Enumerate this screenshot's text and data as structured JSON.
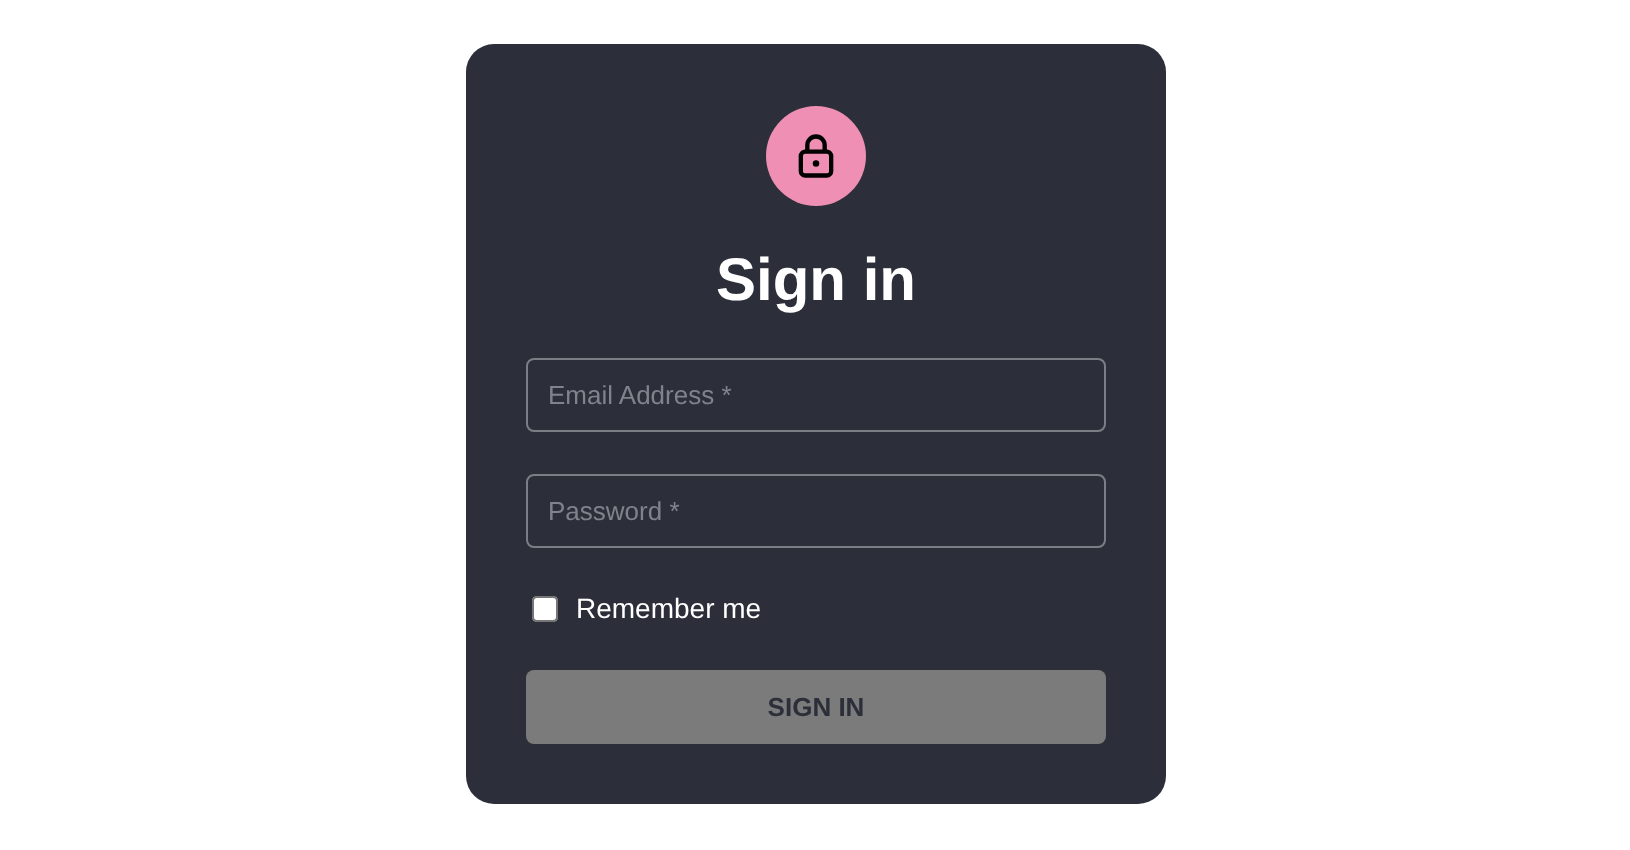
{
  "title": "Sign in",
  "fields": [
    {
      "placeholder": "Email Address *"
    },
    {
      "placeholder": "Password *"
    }
  ],
  "remember": {
    "label": "Remember me",
    "checked": false
  },
  "button": {
    "label": "SIGN IN"
  }
}
